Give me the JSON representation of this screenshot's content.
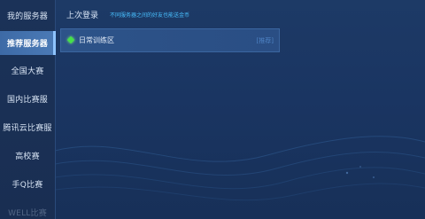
{
  "sidebar": {
    "items": [
      {
        "label": "我的服务器"
      },
      {
        "label": "推荐服务器"
      },
      {
        "label": "全国大赛"
      },
      {
        "label": "国内比赛服"
      },
      {
        "label": "腾讯云比赛服"
      },
      {
        "label": "高校赛"
      },
      {
        "label": "手Q比赛"
      },
      {
        "label": "WELL比赛"
      }
    ],
    "active_index": 1
  },
  "header": {
    "tab_label": "上次登录",
    "hint": "不同服务器之间的好友也能送金币"
  },
  "server_list": [
    {
      "name": "日常训练区",
      "tag": "[推荐]",
      "status": "online"
    }
  ],
  "colors": {
    "background": "#1a3560",
    "active_tab": "#4b7ab6",
    "hint": "#48c0ff",
    "status_online": "#46e04a"
  }
}
